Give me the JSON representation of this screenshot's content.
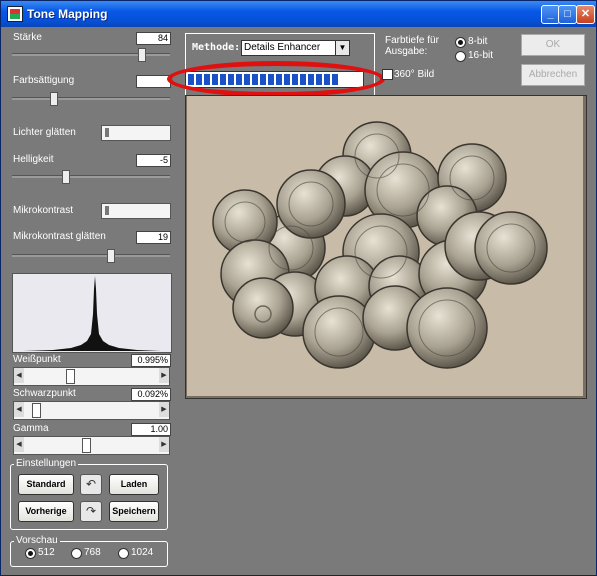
{
  "window": {
    "title": "Tone Mapping"
  },
  "controls": {
    "staerke": {
      "label": "Stärke",
      "value": "84",
      "level": 0.84
    },
    "farbsaettigung": {
      "label": "Farbsättigung",
      "value": "",
      "level": 0.25
    },
    "lichter_glaetten": {
      "label": "Lichter glätten",
      "level": 0.02
    },
    "helligkeit": {
      "label": "Helligkeit",
      "value": "-5",
      "level": 0.33
    },
    "mikrokontrast": {
      "label": "Mikrokontrast",
      "level": 0.02
    },
    "mikrokontrast_glaetten": {
      "label": "Mikrokontrast glätten",
      "value": "19",
      "level": 0.63
    },
    "weisspunkt": {
      "label": "Weißpunkt",
      "value": "0.995%",
      "level": 0.33
    },
    "schwarzpunkt": {
      "label": "Schwarzpunkt",
      "value": "0.092%",
      "level": 0.06
    },
    "gamma": {
      "label": "Gamma",
      "value": "1.00",
      "level": 0.46
    }
  },
  "einstellungen": {
    "title": "Einstellungen",
    "standard": "Standard",
    "laden": "Laden",
    "vorherige": "Vorherige",
    "speichern": "Speichern"
  },
  "vorschau": {
    "title": "Vorschau",
    "options": [
      "512",
      "768",
      "1024"
    ],
    "selected": "512"
  },
  "methode": {
    "label": "Methode:",
    "value": "Details Enhancer",
    "progress": 0.9
  },
  "farbtiefe": {
    "label": "Farbtiefe für Ausgabe:",
    "options": [
      "8-bit",
      "16-bit"
    ],
    "selected": "8-bit"
  },
  "bild360": {
    "label": "360° Bild",
    "checked": false
  },
  "buttons": {
    "ok": "OK",
    "abbrechen": "Abbrechen"
  },
  "colors": {
    "titlebar": "#0858e6",
    "background": "#7a7a7a",
    "progress": "#1a52c4",
    "highlight": "#e01010"
  }
}
